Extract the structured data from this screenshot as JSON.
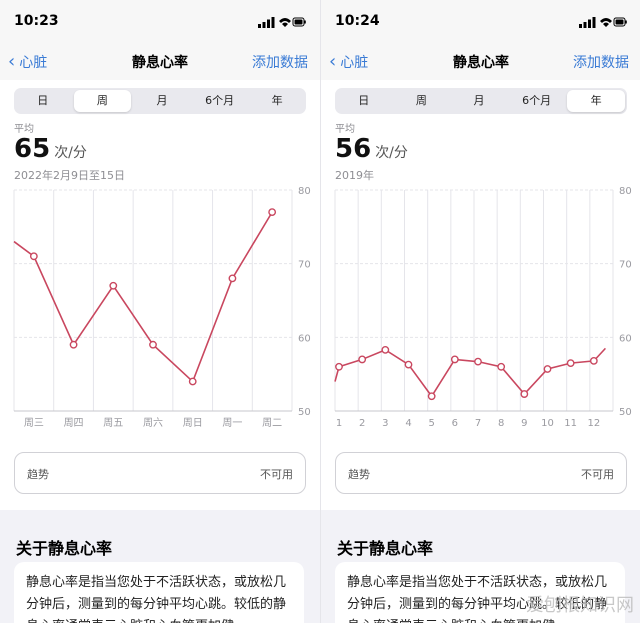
{
  "panels": [
    {
      "time": "10:23",
      "nav": {
        "back": "心脏",
        "title": "静息心率",
        "add": "添加数据"
      },
      "segments": [
        "日",
        "周",
        "月",
        "6个月",
        "年"
      ],
      "selected_segment": 1,
      "avg_label": "平均",
      "avg_value": "65",
      "avg_unit": "次/分",
      "range": "2022年2月9日至15日",
      "trend_label": "趋势",
      "trend_value": "不可用",
      "about_title": "关于静息心率",
      "about_text": "静息心率是指当您处于不活跃状态，或放松几分钟后，测量到的每分钟平均心跳。较低的静息心率通常表示心脏和心血管更加健"
    },
    {
      "time": "10:24",
      "nav": {
        "back": "心脏",
        "title": "静息心率",
        "add": "添加数据"
      },
      "segments": [
        "日",
        "周",
        "月",
        "6个月",
        "年"
      ],
      "selected_segment": 4,
      "avg_label": "平均",
      "avg_value": "56",
      "avg_unit": "次/分",
      "range": "2019年",
      "trend_label": "趋势",
      "trend_value": "不可用",
      "about_title": "关于静息心率",
      "about_text": "静息心率是指当您处于不活跃状态，或放松几分钟后，测量到的每分钟平均心跳。较低的静息心率通常表示心脏和心血管更加健"
    }
  ],
  "chart_data": [
    {
      "type": "line",
      "categories": [
        "周三",
        "周四",
        "周五",
        "周六",
        "周日",
        "周一",
        "周二"
      ],
      "x": [
        -0.5,
        0,
        1,
        2,
        3,
        4,
        5,
        6
      ],
      "values": [
        73,
        71,
        59,
        67,
        59,
        54,
        68,
        77
      ],
      "yticks": [
        80,
        70,
        60,
        50
      ],
      "ylim": [
        50,
        80
      ],
      "color": "#c9475f"
    },
    {
      "type": "line",
      "categories": [
        "1",
        "2",
        "3",
        "4",
        "5",
        "6",
        "7",
        "8",
        "9",
        "10",
        "11",
        "12"
      ],
      "x": [
        0.5,
        1,
        2,
        3,
        4,
        5,
        6,
        7,
        8,
        9,
        10,
        11,
        12,
        12.5
      ],
      "values": [
        54,
        56,
        57,
        58.3,
        56.3,
        52,
        57,
        56.7,
        56,
        52.3,
        55.7,
        56.5,
        56.8,
        58.5
      ],
      "yticks": [
        80,
        70,
        60,
        50
      ],
      "ylim": [
        50,
        80
      ],
      "color": "#c9475f"
    }
  ],
  "watermark": "爱刨根知识网"
}
